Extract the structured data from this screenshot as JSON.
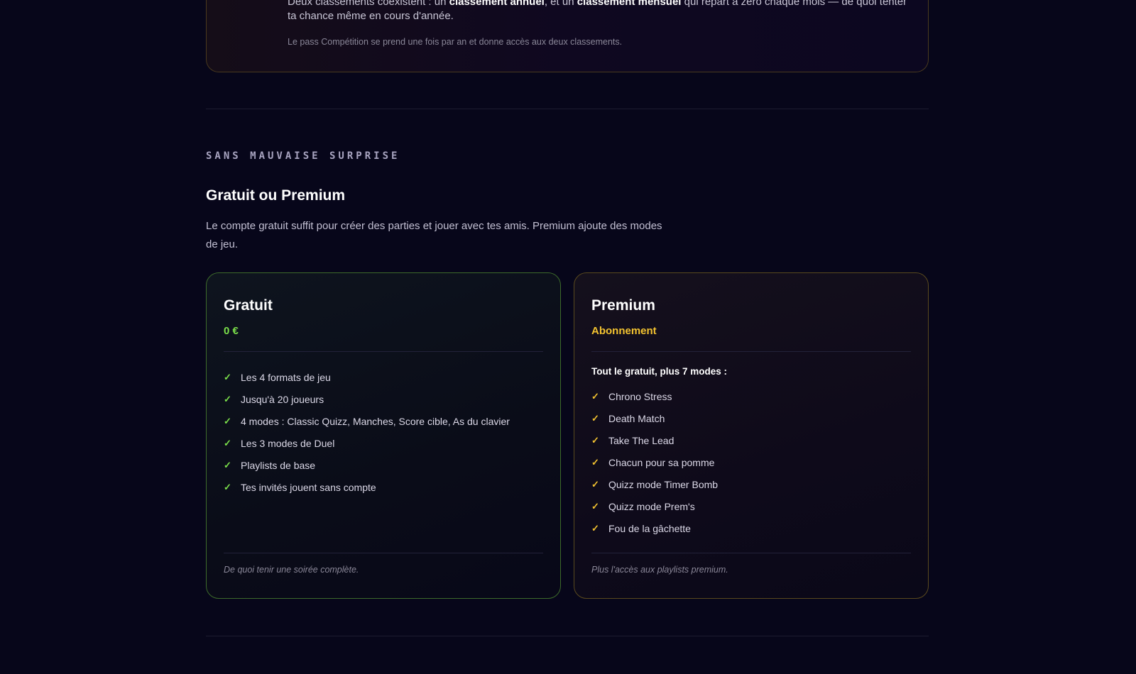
{
  "competition": {
    "line1_prefix": "Deux classements coexistent : un ",
    "line1_bold1": "classement annuel",
    "line1_mid": ", et un ",
    "line1_bold2": "classement mensuel",
    "line1_suffix": " qui repart à zéro chaque mois — de quoi tenter",
    "line2": "ta chance même en cours d'année.",
    "note": "Le pass Compétition se prend une fois par an et donne accès aux deux classements."
  },
  "section": {
    "eyebrow": "SANS MAUVAISE SURPRISE",
    "title": "Gratuit ou Premium",
    "description": "Le compte gratuit suffit pour créer des parties et jouer avec tes amis. Premium ajoute des modes de jeu."
  },
  "plans": {
    "free": {
      "name": "Gratuit",
      "price": "0 €",
      "features": [
        "Les 4 formats de jeu",
        "Jusqu'à 20 joueurs",
        "4 modes : Classic Quizz, Manches, Score cible, As du clavier",
        "Les 3 modes de Duel",
        "Playlists de base",
        "Tes invités jouent sans compte"
      ],
      "footer": "De quoi tenir une soirée complète.",
      "accent": "#7be04a"
    },
    "premium": {
      "name": "Premium",
      "price": "Abonnement",
      "intro": "Tout le gratuit, plus 7 modes :",
      "features": [
        "Chrono Stress",
        "Death Match",
        "Take The Lead",
        "Chacun pour sa pomme",
        "Quizz mode Timer Bomb",
        "Quizz mode Prem's",
        "Fou de la gâchette"
      ],
      "footer": "Plus l'accès aux playlists premium.",
      "accent": "#f2c230"
    }
  },
  "icons": {
    "check": "check-icon"
  }
}
